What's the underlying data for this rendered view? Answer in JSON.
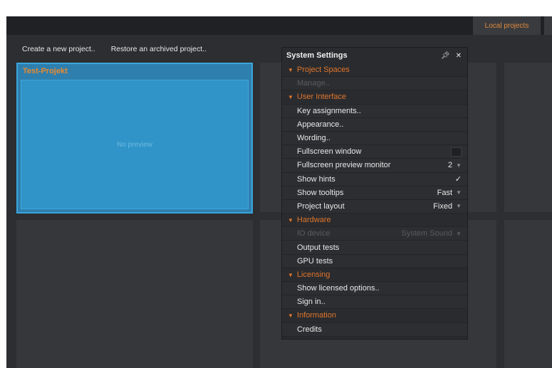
{
  "tabs": {
    "local_projects": "Local projects"
  },
  "actions": {
    "create": "Create a new project..",
    "restore": "Restore an archived project.."
  },
  "project": {
    "title": "Test-Projekt",
    "preview_text": "No preview"
  },
  "settings": {
    "title": "System Settings",
    "sections": {
      "project_spaces": "Project Spaces",
      "user_interface": "User Interface",
      "hardware": "Hardware",
      "licensing": "Licensing",
      "information": "Information"
    },
    "items": {
      "manage": "Manage..",
      "key_assignments": "Key assignments..",
      "appearance": "Appearance..",
      "wording": "Wording..",
      "fullscreen_window": "Fullscreen window",
      "fullscreen_preview_monitor": "Fullscreen preview monitor",
      "fullscreen_preview_monitor_value": "2",
      "show_hints": "Show hints",
      "show_tooltips": "Show tooltips",
      "show_tooltips_value": "Fast",
      "project_layout": "Project layout",
      "project_layout_value": "Fixed",
      "io_device": "IO device",
      "io_device_value": "System Sound",
      "output_tests": "Output tests",
      "gpu_tests": "GPU tests",
      "show_licensed_options": "Show licensed options..",
      "sign_in": "Sign in..",
      "credits": "Credits"
    }
  }
}
